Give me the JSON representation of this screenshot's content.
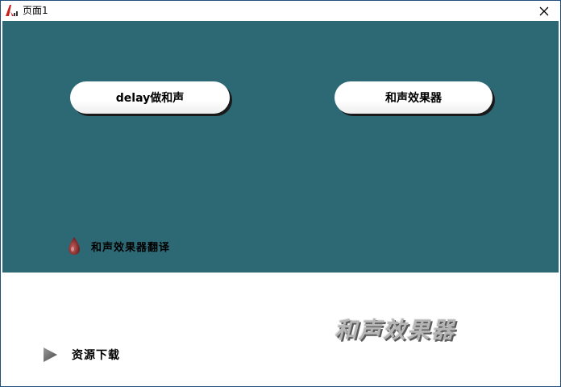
{
  "window": {
    "title": "页面1"
  },
  "main": {
    "delay_button_label": "delay做和声",
    "chorus_button_label": "和声效果器",
    "translate_link_label": "和声效果器翻译"
  },
  "footer": {
    "calligraphy_text": "和声效果器",
    "download_link_label": "资源下载"
  },
  "icons": {
    "app": "app-logo-icon",
    "close": "close-icon",
    "drop": "drop-icon",
    "play": "play-triangle-icon"
  },
  "colors": {
    "teal_background": "#2d6875",
    "drop": "#8a2a2a",
    "play": "#6e6e6e"
  }
}
